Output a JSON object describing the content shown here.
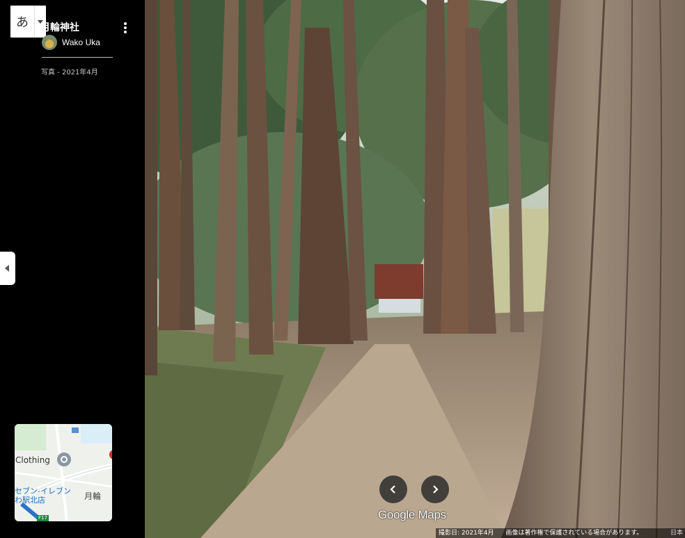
{
  "ime": {
    "char": "あ"
  },
  "header": {
    "title": "月輪神社",
    "author": "Wako Uka",
    "date": "写真 - 2021年4月"
  },
  "minimap": {
    "label_clothing": "Clothing",
    "label_store": "セブン-イレブン\nわ駅北店",
    "label_town": "月輪",
    "route": "F17"
  },
  "brand": {
    "logo": "Google Maps"
  },
  "footer": {
    "capture_date": "撮影日: 2021年4月",
    "copyright": "画像は著作権で保護されている場合があります。",
    "language": "日本"
  },
  "colors": {
    "panel_bg": "#000000",
    "nav_button": "#2d2d2d",
    "map_pin": "#7f8c99"
  },
  "icons": {
    "more": "more-vert-icon",
    "collapse": "chevron-left-icon",
    "prev": "chevron-left-icon",
    "next": "chevron-right-icon",
    "ime_caret": "caret-down-icon"
  }
}
